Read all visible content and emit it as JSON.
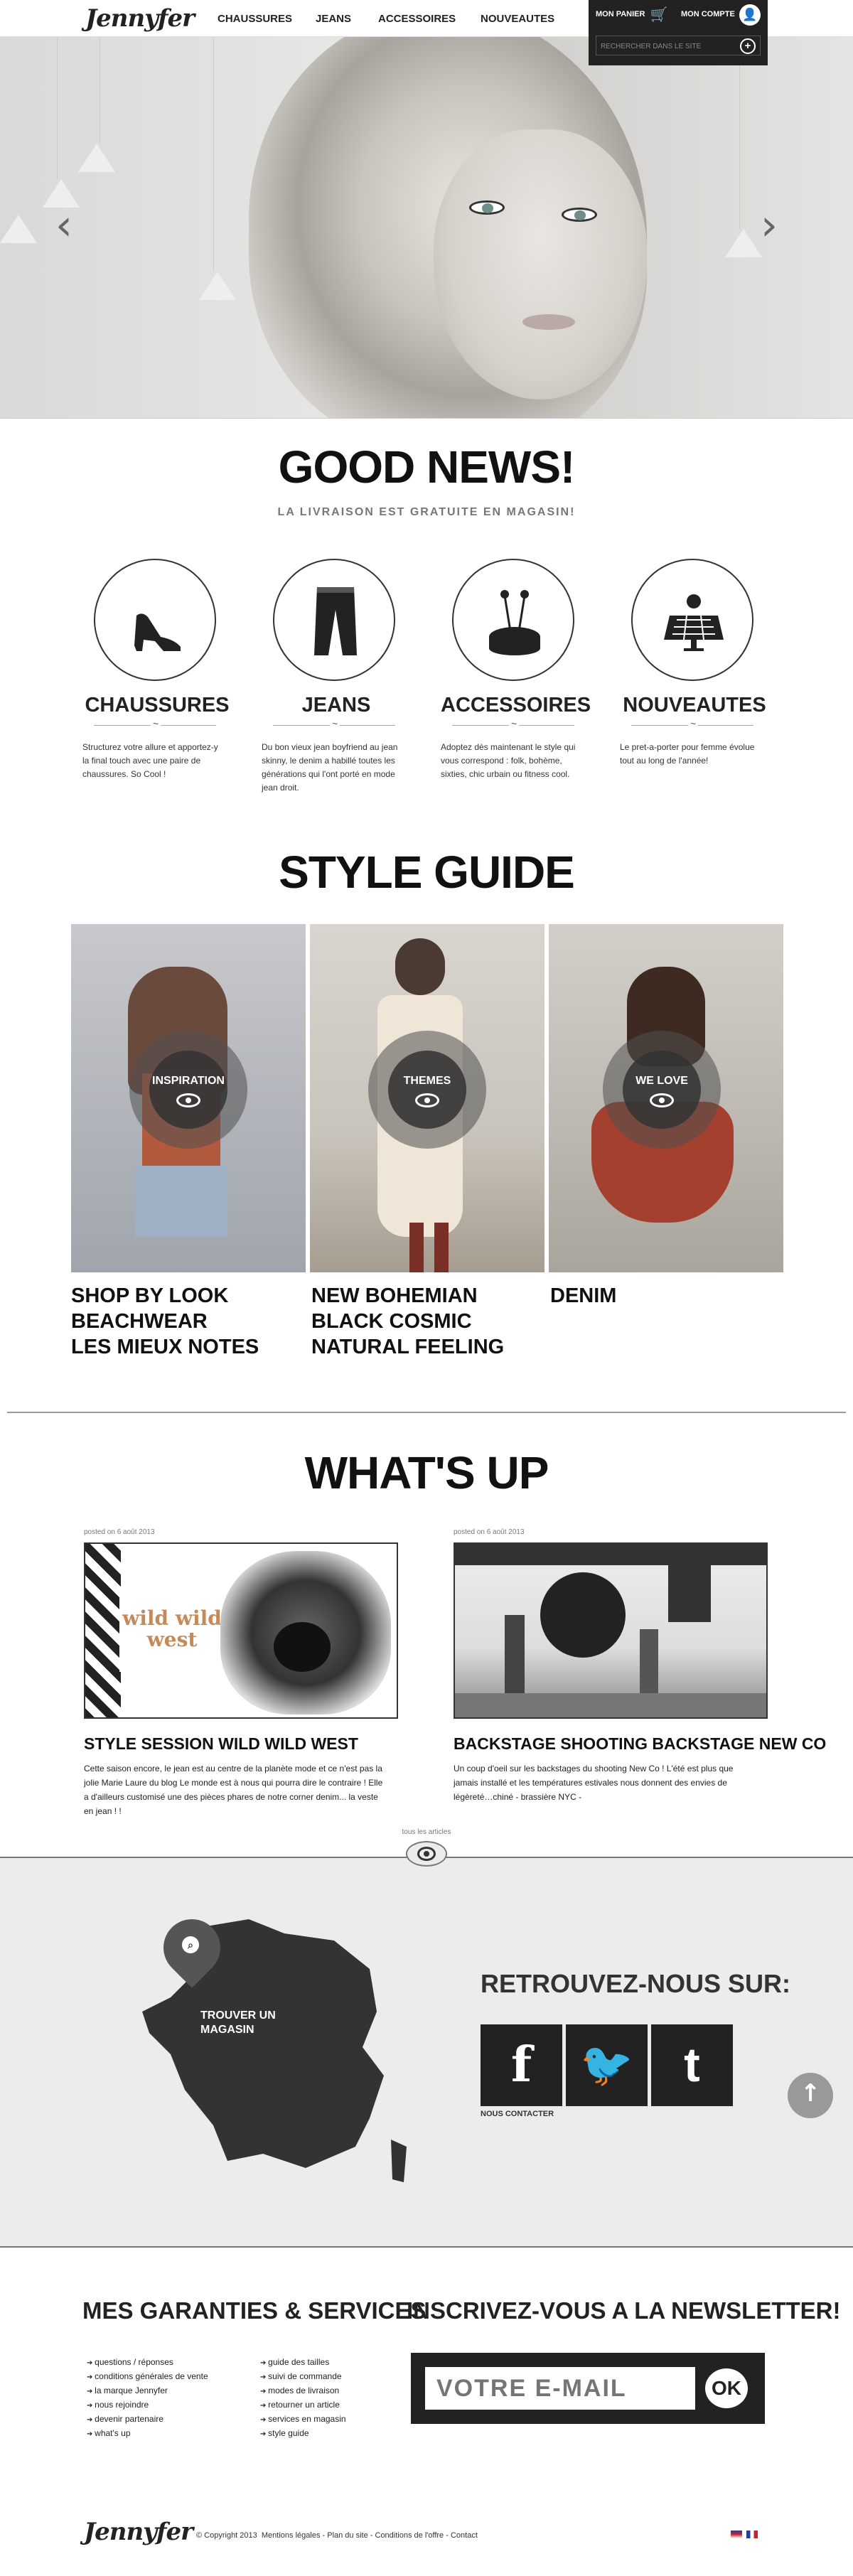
{
  "header": {
    "logo": "Jennyfer",
    "nav": [
      "CHAUSSURES",
      "JEANS",
      "ACCESSOIRES",
      "NOUVEAUTES"
    ],
    "cart_label": "MON PANIER",
    "account_label": "MON COMPTE",
    "search_placeholder": "RECHERCHER DANS LE SITE"
  },
  "good_news": {
    "title": "GOOD NEWS!",
    "subtitle": "LA LIVRAISON EST GRATUITE EN MAGASIN!",
    "categories": [
      {
        "title": "CHAUSSURES",
        "icon": "shoe-icon",
        "text": "Structurez votre allure et apportez-y la final touch avec une paire de chaussures. So Cool !"
      },
      {
        "title": "JEANS",
        "icon": "jeans-icon",
        "text": "Du bon vieux jean boyfriend au jean skinny, le denim a habillé toutes les générations qui l'ont porté en mode jean droit."
      },
      {
        "title": "ACCESSOIRES",
        "icon": "pincushion-icon",
        "text": "Adoptez dès maintenant le style qui vous correspond : folk, bohème, sixties, chic urbain ou fitness cool."
      },
      {
        "title": "NOUVEAUTES",
        "icon": "solar-panel-icon",
        "text": "Le pret-a-porter pour femme évolue tout au long de l'année!"
      }
    ]
  },
  "style_guide": {
    "title": "STYLE GUIDE",
    "panels": [
      "INSPIRATION",
      "THEMES",
      "WE LOVE"
    ],
    "col1": [
      "SHOP BY LOOK",
      "BEACHWEAR",
      "LES MIEUX NOTES"
    ],
    "col2": [
      "NEW BOHEMIAN",
      "BLACK COSMIC",
      "NATURAL FEELING"
    ],
    "col3": [
      "DENIM"
    ]
  },
  "whats_up": {
    "title": "WHAT'S UP",
    "posts": [
      {
        "date": "posted on 6 août 2013",
        "image_text": "wild wild west",
        "title": "STYLE SESSION WILD WILD WEST",
        "text": "Cette saison encore, le jean est au centre de la planète mode et ce n'est pas la jolie Marie Laure du blog Le monde est à nous qui pourra dire le contraire ! Elle a d'ailleurs customisé une des pièces phares de notre corner denim... la veste en jean ! !"
      },
      {
        "date": "posted on 6 août 2013",
        "title": "BACKSTAGE SHOOTING BACKSTAGE NEW CO",
        "text": "Un coup d'oeil sur les backstages du shooting New Co ! L'été est plus que jamais installé et les températures estivales nous donnent des envies de légèreté…chiné - brassière NYC -"
      }
    ],
    "all_articles": "tous les articles"
  },
  "stores": {
    "map_label": "TROUVER UN MAGASIN",
    "social_title": "RETROUVEZ-NOUS SUR:",
    "social": [
      "f",
      "t",
      "t"
    ],
    "contact": "NOUS CONTACTER"
  },
  "footer": {
    "services_title": "MES GARANTIES & SERVICES",
    "links_col1": [
      "questions / réponses",
      "conditions générales de vente",
      "la marque Jennyfer",
      "nous rejoindre",
      "devenir partenaire",
      "what's up"
    ],
    "links_col2": [
      "guide des tailles",
      "suivi de commande",
      "modes de livraison",
      "retourner un article",
      "services en magasin",
      "style guide"
    ],
    "newsletter_title": "INSCRIVEZ-VOUS A LA NEWSLETTER!",
    "email_placeholder": "VOTRE E-MAIL",
    "ok": "OK",
    "logo": "Jennyfer",
    "copyright": "© Copyright 2013",
    "bottom_links": [
      "Mentions légales",
      "Plan du site",
      "Conditions de l'offre",
      "Contact"
    ]
  },
  "colors": {
    "dark": "#222222",
    "map_bg": "#ececec",
    "accent_muted": "#777777"
  }
}
